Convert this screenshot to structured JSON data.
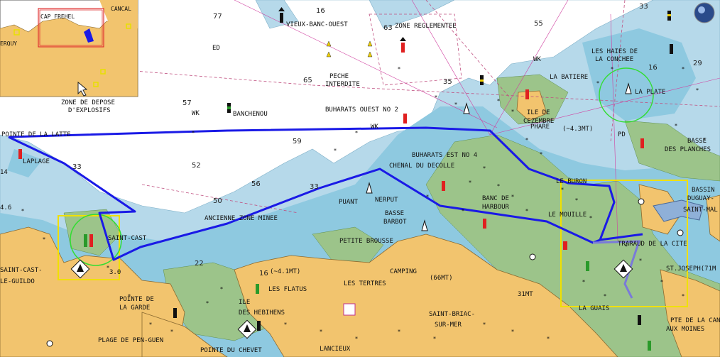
{
  "colors": {
    "deep_water": "#ffffff",
    "shallow_water": "#b6d9ea",
    "very_shallow": "#8ec9e0",
    "drying": "#9cc48a",
    "land": "#f2c46e",
    "route": "#1a1ae6",
    "route_secondary": "#7a7ad9",
    "highlight_box": "#f0e000",
    "circle": "#33dd33",
    "inset_border": "#e03030"
  },
  "inset": {
    "labels": {
      "cap_frehel": "CAP FREHEL",
      "cancal": "CANCAL",
      "erquy": "ERQUY"
    }
  },
  "labels": {
    "vieux_banc_ouest": "VIEUX-BANC-OUEST",
    "zone_reglementee": "ZONE REGLEMENTEE",
    "peche_interdite_1": "PECHE",
    "peche_interdite_2": "INTERDITE",
    "buharats_ouest": "BUHARATS OUEST NO 2",
    "zone_depose_1": "ZONE DE DEPOSE",
    "zone_depose_2": "D'EXPLOSIFS",
    "banchenou": "BANCHENOU",
    "pointe_la_latte": "POINTE DE LA LATTE",
    "laplage": "LAPLAGE",
    "la_batiere": "LA BATIERE",
    "haies_1": "LES HAIES DE",
    "haies_2": "LA CONCHEE",
    "la_plate": "LA PLATE",
    "ile_cezembre_1": "ILE DE",
    "ile_cezembre_2": "CEZEMBRE",
    "phare": "PHARE",
    "dist_43": "(~4.3MT)",
    "pd": "PD",
    "basse_planches_1": "BASSE",
    "basse_planches_2": "DES PLANCHES",
    "buharats_est": "BUHARATS EST NO 4",
    "chenal_decolle": "CHENAL DU DECOLLE",
    "le_buron": "LE BURON",
    "bassin_1": "BASSIN",
    "bassin_2": "DUGUAY-",
    "bassin_3": "SAINT-MAL",
    "puant": "PUANT",
    "nerput": "NERPUT",
    "banc_harbour_1": "BANC DE",
    "banc_harbour_2": "HARBOUR",
    "basse_barbot_1": "BASSE",
    "basse_barbot_2": "BARBOT",
    "le_mouillet": "LE MOUILLE",
    "ancienne_zone": "ANCIENNE ZONE MINEE",
    "saint_cast": "SAINT-CAST",
    "petite_brousse": "PETITE BROUSSE",
    "traraud": "TRARAUD DE LA CITE",
    "saint_cast_guildo_1": "SAINT-CAST-",
    "saint_cast_guildo_2": "LE-GUILDO",
    "camping": "CAMPING",
    "dist_66": "(66MT)",
    "st_joseph": "ST.JOSEPH(71M",
    "les_tertres": "LES TERTRES",
    "dist_41": "(~4.1MT)",
    "les_flatus": "LES FLATUS",
    "mt_31": "31MT",
    "pointe_garde_1": "POINTE DE",
    "pointe_garde_2": "LA GARDE",
    "hebihens_1": "ILE",
    "hebihens_2": "DES HEBIHENS",
    "saint_briac_1": "SAINT-BRIAC-",
    "saint_briac_2": "SUR-MER",
    "la_guais": "LA GUAIS",
    "pte_cancaval_1": "PTE DE LA CAN",
    "pte_cancaval_2": "AUX MOINES",
    "plage_pen_guen": "PLAGE DE PEN-GUEN",
    "pointe_chevet": "POINTE DU CHEVET",
    "lancieux": "LANCIEUX",
    "ed": "ED",
    "wk_1": "WK",
    "wk_2": "WK",
    "wk_3": "WK",
    "depth_30": "3.0",
    "depth_46": "4.6",
    "depth_14": "14"
  },
  "soundings": [
    "77",
    "16",
    "63",
    "55",
    "33",
    "65",
    "57",
    "59",
    "52",
    "56",
    "33",
    "50",
    "22",
    "16",
    "35",
    "29",
    "16",
    "33"
  ]
}
